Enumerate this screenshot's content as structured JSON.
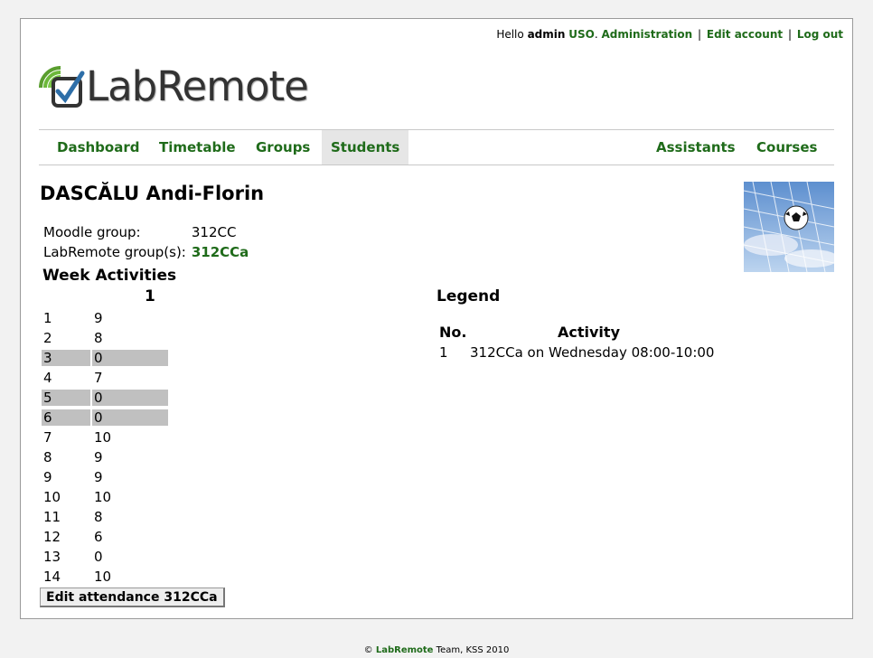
{
  "topbar": {
    "hello": "Hello",
    "username": "admin",
    "group": "USO",
    "admin_link": "Administration",
    "edit_link": "Edit account",
    "logout_link": "Log out"
  },
  "logo": {
    "text": "LabRemote"
  },
  "nav": {
    "dashboard": "Dashboard",
    "timetable": "Timetable",
    "groups": "Groups",
    "students": "Students",
    "assistants": "Assistants",
    "courses": "Courses",
    "active": "Students"
  },
  "student": {
    "name": "DASCĂLU Andi-Florin",
    "moodle_label": "Moodle group:",
    "moodle_value": "312CC",
    "labremote_label": "LabRemote group(s):",
    "labremote_value": "312CCa"
  },
  "attendance": {
    "week_header": "Week",
    "activities_header": "Activities",
    "activity_col": "1",
    "rows": [
      {
        "week": "1",
        "value": "9",
        "missed": false
      },
      {
        "week": "2",
        "value": "8",
        "missed": false
      },
      {
        "week": "3",
        "value": "0",
        "missed": true
      },
      {
        "week": "4",
        "value": "7",
        "missed": false
      },
      {
        "week": "5",
        "value": "0",
        "missed": true
      },
      {
        "week": "6",
        "value": "0",
        "missed": true
      },
      {
        "week": "7",
        "value": "10",
        "missed": false
      },
      {
        "week": "8",
        "value": "9",
        "missed": false
      },
      {
        "week": "9",
        "value": "9",
        "missed": false
      },
      {
        "week": "10",
        "value": "10",
        "missed": false
      },
      {
        "week": "11",
        "value": "8",
        "missed": false
      },
      {
        "week": "12",
        "value": "6",
        "missed": false
      },
      {
        "week": "13",
        "value": "0",
        "missed": false
      },
      {
        "week": "14",
        "value": "10",
        "missed": false
      }
    ],
    "edit_button": "Edit attendance 312CCa"
  },
  "legend": {
    "title": "Legend",
    "no_header": "No.",
    "activity_header": "Activity",
    "items": [
      {
        "no": "1",
        "activity": "312CCa on Wednesday 08:00-10:00"
      }
    ]
  },
  "footer": {
    "copyright": "©",
    "brand": "LabRemote",
    "rest": "Team, KSS 2010"
  },
  "colors": {
    "link": "#1f6b1a",
    "missed_row": "#c0c0c0",
    "active_tab": "#e6e6e6"
  },
  "icons": {
    "logo": "signal-checkbox-icon",
    "avatar": "soccer-ball-net-image"
  }
}
